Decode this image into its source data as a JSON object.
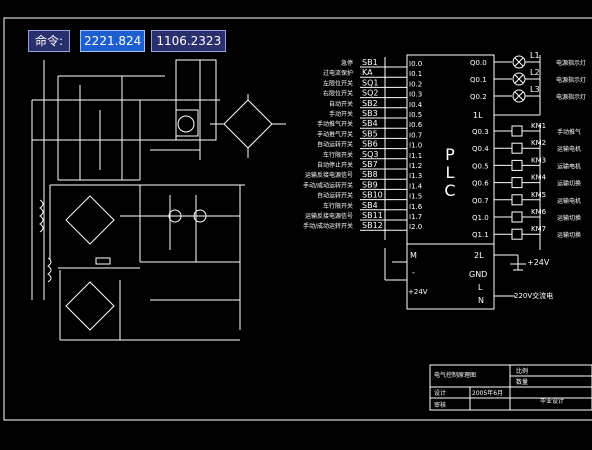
{
  "command_bar": {
    "label": "命令:",
    "x_value": "2221.824",
    "y_value": "1106.2323"
  },
  "plc": {
    "title": "PLC",
    "inputs": [
      {
        "desc": "急停",
        "dev": "SB1",
        "port": "I0.0"
      },
      {
        "desc": "过电流保护",
        "dev": "KA",
        "port": "I0.1"
      },
      {
        "desc": "左限位开关",
        "dev": "SQ1",
        "port": "I0.2"
      },
      {
        "desc": "右限位开关",
        "dev": "SQ2",
        "port": "I0.3"
      },
      {
        "desc": "自动开关",
        "dev": "SB2",
        "port": "I0.4"
      },
      {
        "desc": "手动开关",
        "dev": "SB3",
        "port": "I0.5"
      },
      {
        "desc": "手动推气开关",
        "dev": "SB4",
        "port": "I0.6"
      },
      {
        "desc": "手动推气开关",
        "dev": "SB5",
        "port": "I0.7"
      },
      {
        "desc": "自动运转开关",
        "dev": "SB6",
        "port": "I1.0"
      },
      {
        "desc": "车行限开关",
        "dev": "SQ3",
        "port": "I1.1"
      },
      {
        "desc": "自动停止开关",
        "dev": "SB7",
        "port": "I1.2"
      },
      {
        "desc": "运输反接电源信号",
        "dev": "SB8",
        "port": "I1.3"
      },
      {
        "desc": "手动/成动运转开关",
        "dev": "SB9",
        "port": "I1.4"
      },
      {
        "desc": "自动运转开关",
        "dev": "SB10",
        "port": "I1.5"
      },
      {
        "desc": "车行限开关",
        "dev": "SB4",
        "port": "I1.6"
      },
      {
        "desc": "运输反接电源信号",
        "dev": "SB11",
        "port": "I1.7"
      },
      {
        "desc": "手动/成动运转开关",
        "dev": "SB12",
        "port": "I2.0"
      }
    ],
    "outputs_top": [
      {
        "port": "Q0.0",
        "lamp": "L1",
        "desc": "电源指示灯"
      },
      {
        "port": "Q0.1",
        "lamp": "L2",
        "desc": "电源指示灯"
      },
      {
        "port": "Q0.2",
        "lamp": "L3",
        "desc": "电源指示灯"
      }
    ],
    "outputs": [
      {
        "port": "Q0.3",
        "coil": "KM1",
        "desc": "手动推气"
      },
      {
        "port": "Q0.4",
        "coil": "KM2",
        "desc": "运输电机"
      },
      {
        "port": "Q0.5",
        "coil": "KM3",
        "desc": "运输电机"
      },
      {
        "port": "Q0.6",
        "coil": "KM4",
        "desc": "运输切换"
      },
      {
        "port": "Q0.7",
        "coil": "KM5",
        "desc": "运输电机"
      },
      {
        "port": "Q1.0",
        "coil": "KM6",
        "desc": "运输切换"
      },
      {
        "port": "Q1.1",
        "coil": "KM7",
        "desc": "运输切换"
      }
    ],
    "common_1l": "1L",
    "common_2l": "2L",
    "gnd": "GND",
    "l": "L",
    "n": "N",
    "m": "M",
    "minus": "-",
    "plus24_in": "+24V",
    "plus24_out": "+24V",
    "ac220": "220V交流电"
  },
  "title_block": {
    "title": "电气控制原理图",
    "ratio": "比例",
    "qty": "数量",
    "design": "设计",
    "date": "2005年6月",
    "review": "审核",
    "graduation": "毕业设计"
  }
}
